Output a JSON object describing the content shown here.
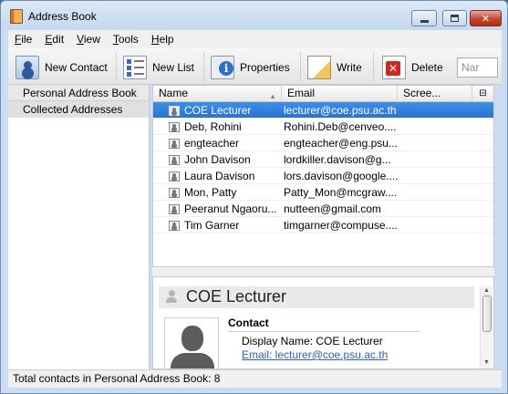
{
  "window": {
    "title": "Address Book",
    "controls": {
      "minimize": "",
      "maximize": "",
      "close": "✕"
    }
  },
  "menu": [
    {
      "accel": "F",
      "rest": "ile"
    },
    {
      "accel": "E",
      "rest": "dit"
    },
    {
      "accel": "V",
      "rest": "iew"
    },
    {
      "accel": "T",
      "rest": "ools"
    },
    {
      "accel": "H",
      "rest": "elp"
    }
  ],
  "toolbar": {
    "new_contact": "New Contact",
    "new_list": "New List",
    "properties": "Properties",
    "write": "Write",
    "delete": "Delete",
    "search_placeholder": "Nar"
  },
  "sidebar": {
    "items": [
      {
        "label": "Personal Address Book"
      },
      {
        "label": "Collected Addresses"
      }
    ]
  },
  "table": {
    "columns": {
      "name": "Name",
      "email": "Email",
      "screen": "Scree...",
      "picker": "⊟"
    },
    "rows": [
      {
        "name": "COE Lecturer",
        "email": "lecturer@coe.psu.ac.th"
      },
      {
        "name": "Deb, Rohini",
        "email": "Rohini.Deb@cenveo...."
      },
      {
        "name": "engteacher",
        "email": "engteacher@eng.psu...."
      },
      {
        "name": "John Davison",
        "email": "lordkiller.davison@g..."
      },
      {
        "name": "Laura Davison",
        "email": "lors.davison@google...."
      },
      {
        "name": "Mon, Patty",
        "email": "Patty_Mon@mcgraw...."
      },
      {
        "name": "Peeranut Ngaoru...",
        "email": "nutteen@gmail.com"
      },
      {
        "name": "Tim Garner",
        "email": "timgarner@compuse...."
      }
    ]
  },
  "card": {
    "name": "COE Lecturer",
    "section": "Contact",
    "display_name": "Display Name: COE Lecturer",
    "email": "Email: lecturer@coe.psu.ac.th"
  },
  "status": {
    "text": "Total contacts in Personal Address Book: 8"
  }
}
